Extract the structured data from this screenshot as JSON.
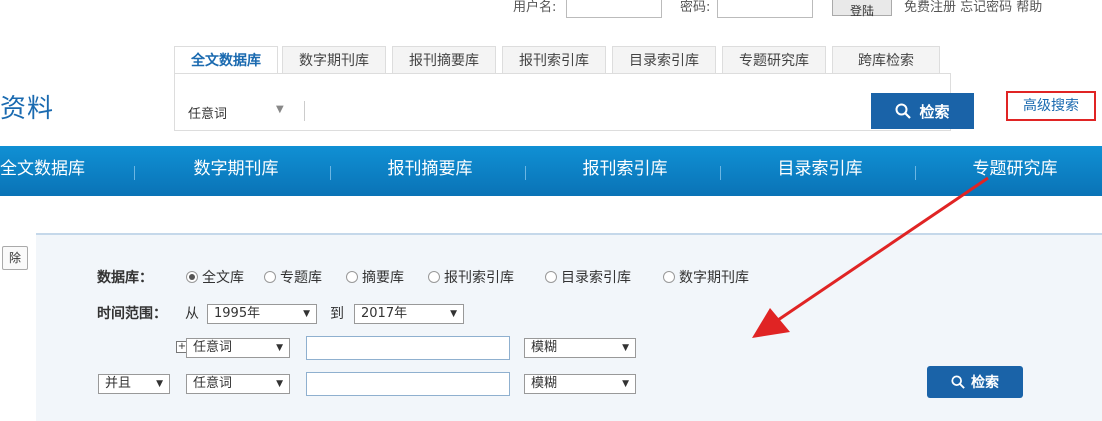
{
  "top": {
    "username_label": "用户名:",
    "password_label": "密码:",
    "login": "登陆",
    "links": "免费注册  忘记密码  帮助"
  },
  "logo": "资料",
  "tabs": [
    "全文数据库",
    "数字期刊库",
    "报刊摘要库",
    "报刊索引库",
    "目录索引库",
    "专题研究库",
    "跨库检索"
  ],
  "search": {
    "field": "任意词",
    "button": "检索"
  },
  "advanced_search": "高级搜索",
  "nav": [
    "全文数据库",
    "数字期刊库",
    "报刊摘要库",
    "报刊索引库",
    "目录索引库",
    "专题研究库"
  ],
  "left_button": "除",
  "form": {
    "db_label": "数据库：",
    "db_options": [
      "全文库",
      "专题库",
      "摘要库",
      "报刊索引库",
      "目录索引库",
      "数字期刊库"
    ],
    "time_label": "时间范围：",
    "from": "从",
    "from_year": "1995年",
    "to": "到",
    "to_year": "2017年",
    "row1_field": "任意词",
    "row1_match": "模糊",
    "row2_logic": "并且",
    "row2_field": "任意词",
    "row2_match": "模糊",
    "submit": "检索"
  },
  "colors": {
    "brand_blue": "#1a63a8",
    "nav_blue": "#0c7fc2",
    "highlight_red": "#e02424"
  }
}
